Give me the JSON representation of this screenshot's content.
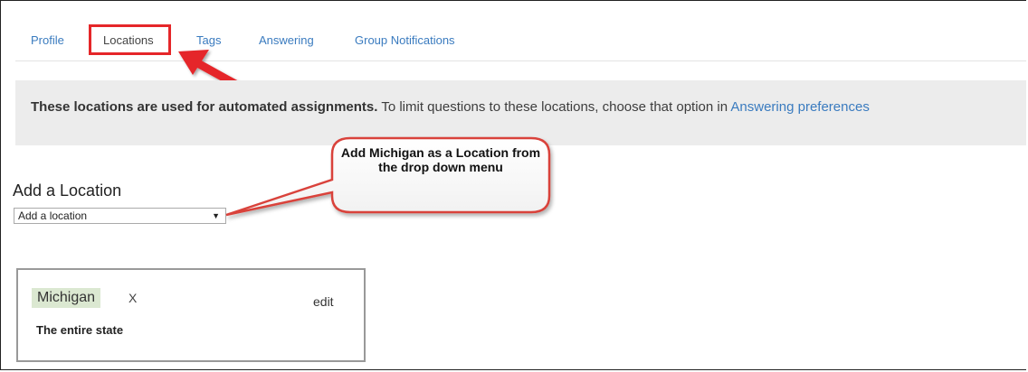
{
  "tabs": [
    {
      "label": "Profile",
      "active": false
    },
    {
      "label": "Locations",
      "active": true
    },
    {
      "label": "Tags",
      "active": false
    },
    {
      "label": "Answering",
      "active": false
    },
    {
      "label": "Group Notifications",
      "active": false
    }
  ],
  "banner": {
    "bold_text": "These locations are used for automated assignments.",
    "text": " To limit questions to these locations, choose that option in ",
    "link_text": "Answering preferences"
  },
  "add_location": {
    "heading": "Add a Location",
    "select_value": "Add a location"
  },
  "callout": {
    "text": "Add Michigan as a Location from the drop down menu"
  },
  "location_card": {
    "name": "Michigan",
    "remove_label": "X",
    "edit_label": "edit",
    "scope": "The entire state"
  },
  "colors": {
    "highlight": "#e52629",
    "link": "#3a7bbf",
    "pill": "#dbe8d1",
    "banner_bg": "#ececec"
  }
}
